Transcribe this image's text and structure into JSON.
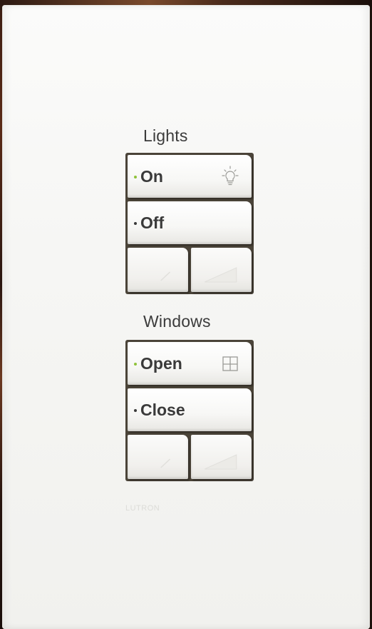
{
  "colors": {
    "indicator_active": "#8fc23a",
    "indicator_inactive": "#3a3a3a",
    "plate": "#f7f7f5"
  },
  "lights": {
    "label": "Lights",
    "buttons": [
      {
        "label": "On",
        "icon": "lightbulb-icon",
        "indicator": "active"
      },
      {
        "label": "Off",
        "indicator": "inactive"
      }
    ],
    "lower_icon": "dim-lower-icon",
    "raise_icon": "dim-raise-icon"
  },
  "windows": {
    "label": "Windows",
    "buttons": [
      {
        "label": "Open",
        "icon": "window-icon",
        "indicator": "active"
      },
      {
        "label": "Close",
        "indicator": "inactive"
      }
    ],
    "lower_icon": "shade-lower-icon",
    "raise_icon": "shade-raise-icon"
  },
  "brand": {
    "logo_text": "LUTRON"
  }
}
